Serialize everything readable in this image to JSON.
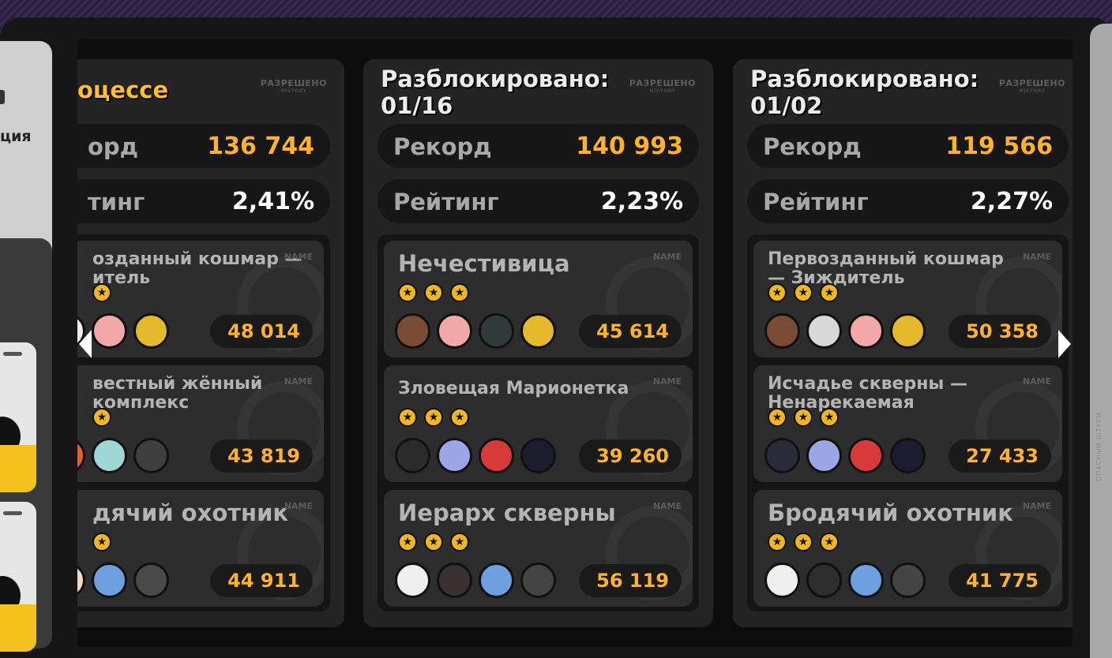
{
  "left_panel": {
    "label": "ция"
  },
  "side_rail": {
    "label": "ОПАСНЫЙ ШТУРМ"
  },
  "allowed_label": "РАЗРЕШЕНО",
  "allowed_sub": "HISTORY",
  "name_tag": "NAME",
  "columns": [
    {
      "header": "оцессе",
      "record_label": "орд",
      "record": "136 744",
      "rating_label": "тинг",
      "rating": "2,41%",
      "stages": [
        {
          "name": "озданный кошмар — итель",
          "stars": 1,
          "score": "48 014"
        },
        {
          "name": "вестный жённый комплекс",
          "stars": 1,
          "score": "43 819"
        },
        {
          "name": "дячий охотник",
          "stars": 1,
          "score": "44 911"
        }
      ]
    },
    {
      "header": "Разблокировано: 01/16",
      "record_label": "Рекорд",
      "record": "140 993",
      "rating_label": "Рейтинг",
      "rating": "2,23%",
      "stages": [
        {
          "name": "Нечестивица",
          "stars": 3,
          "score": "45 614"
        },
        {
          "name": "Зловещая Марионетка",
          "stars": 3,
          "score": "39 260"
        },
        {
          "name": "Иерарх скверны",
          "stars": 3,
          "score": "56 119"
        }
      ]
    },
    {
      "header": "Разблокировано: 01/02",
      "record_label": "Рекорд",
      "record": "119 566",
      "rating_label": "Рейтинг",
      "rating": "2,27%",
      "stages": [
        {
          "name": "Первозданный кошмар — Зиждитель",
          "stars": 3,
          "score": "50 358"
        },
        {
          "name": "Исчадье скверны — Ненарекаемая",
          "stars": 3,
          "score": "27 433"
        },
        {
          "name": "Бродячий охотник",
          "stars": 3,
          "score": "41 775"
        }
      ]
    }
  ],
  "colors": {
    "accent": "#ffb22d",
    "panel": "#242424",
    "card": "#2d2d2d"
  }
}
